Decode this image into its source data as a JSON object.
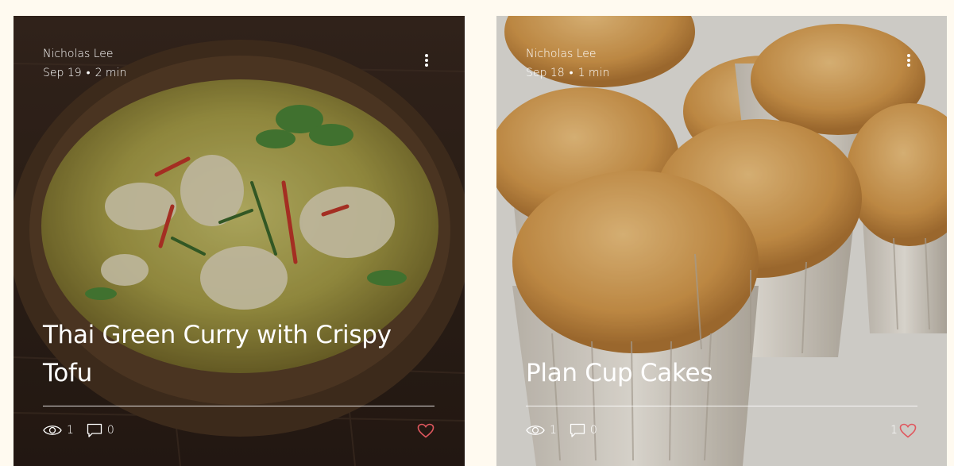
{
  "posts": [
    {
      "author": "Nicholas Lee",
      "date": "Sep 19",
      "separator": "•",
      "read_time": "2 min",
      "title": "Thai Green Curry with Crispy Tofu",
      "views": "1",
      "comments": "0",
      "likes": "",
      "image": "thai-green-curry-bowl",
      "like_color": "#e0575e"
    },
    {
      "author": "Nicholas Lee",
      "date": "Sep 18",
      "separator": "•",
      "read_time": "1 min",
      "title": "Plan Cup Cakes",
      "views": "1",
      "comments": "0",
      "likes": "1",
      "image": "cupcakes",
      "like_color": "#e0575e"
    }
  ],
  "icons": {
    "more": "more-vertical-icon",
    "views": "eye-icon",
    "comments": "comment-icon",
    "like": "heart-icon"
  }
}
